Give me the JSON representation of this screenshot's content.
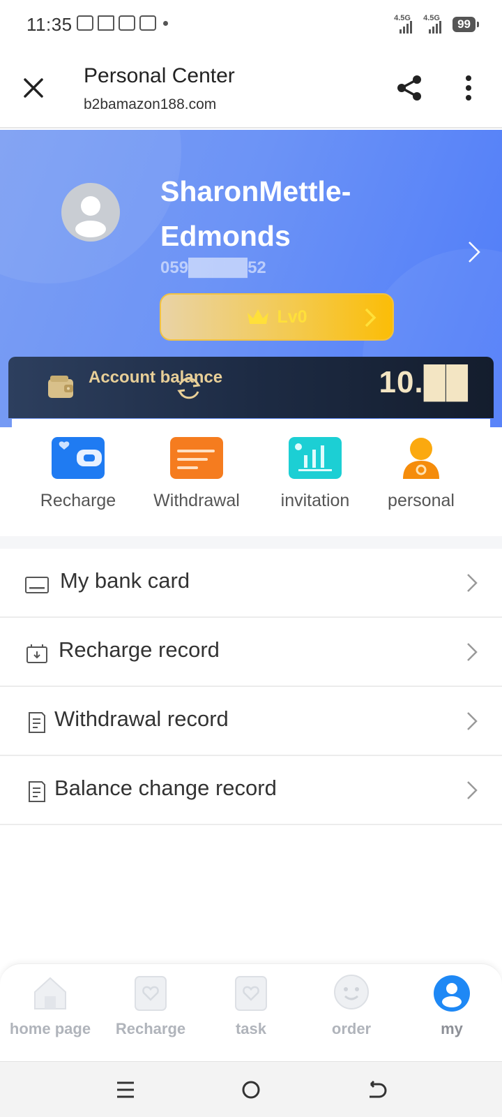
{
  "status_bar": {
    "time": "11:35",
    "network_1": "4.5G",
    "network_2": "4.5G",
    "battery": "99"
  },
  "header": {
    "title": "Personal Center",
    "url": "b2bamazon188.com"
  },
  "profile": {
    "username": "SharonMettle-Edmonds",
    "phone": "059█████52",
    "level": "Lv0"
  },
  "balance": {
    "label": "Account balance",
    "value": "10.██"
  },
  "actions": [
    {
      "label": "Recharge",
      "icon": "wallet-card-icon",
      "color": "#1f7bf2"
    },
    {
      "label": "Withdrawal",
      "icon": "bill-icon",
      "color": "#f57c1f"
    },
    {
      "label": "invitation",
      "icon": "chart-icon",
      "color": "#1ccfd4"
    },
    {
      "label": "personal",
      "icon": "user-gear-icon",
      "color": "#f59a0b"
    }
  ],
  "menu": [
    {
      "label": "My bank card",
      "icon": "bank-card-icon"
    },
    {
      "label": "Recharge record",
      "icon": "recharge-record-icon"
    },
    {
      "label": "Withdrawal record",
      "icon": "document-icon"
    },
    {
      "label": "Balance change record",
      "icon": "document-icon"
    }
  ],
  "tabs": [
    {
      "label": "home page",
      "icon": "home-icon",
      "active": false
    },
    {
      "label": "Recharge",
      "icon": "heart-card-icon",
      "active": false
    },
    {
      "label": "task",
      "icon": "heart-card-icon",
      "active": false
    },
    {
      "label": "order",
      "icon": "chat-face-icon",
      "active": false
    },
    {
      "label": "my",
      "icon": "user-icon",
      "active": true
    }
  ],
  "colors": {
    "hero_start": "#7b9ef3",
    "hero_end": "#4f7cf9",
    "gold": "#fbbd07",
    "balance_bg": "#1d2b44",
    "active_tab": "#1e88f5"
  }
}
